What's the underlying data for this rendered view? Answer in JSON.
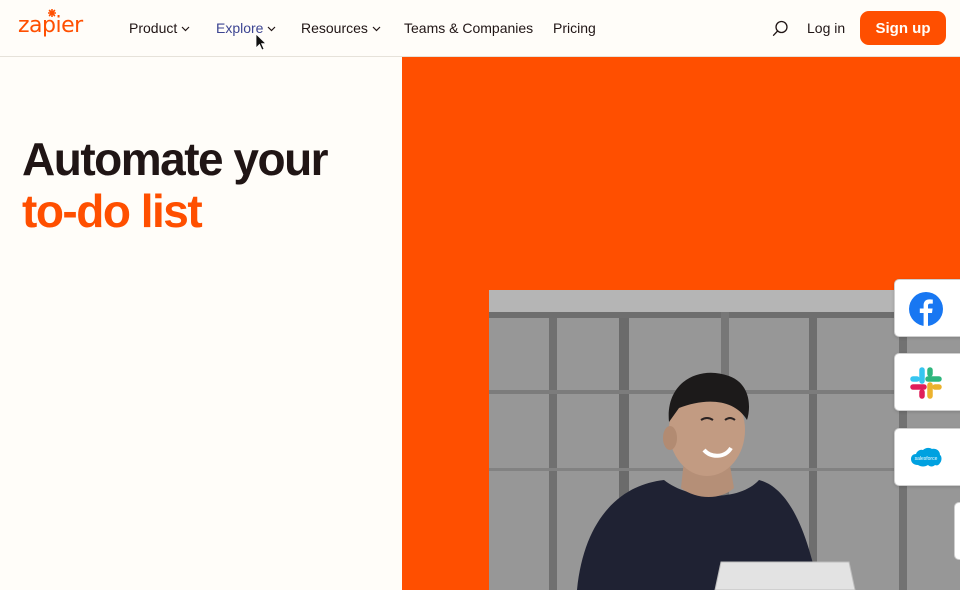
{
  "header": {
    "logo_text": "zapier",
    "nav": [
      {
        "label": "Product",
        "has_dropdown": true
      },
      {
        "label": "Explore",
        "has_dropdown": true,
        "active": true
      },
      {
        "label": "Resources",
        "has_dropdown": true
      },
      {
        "label": "Teams & Companies",
        "has_dropdown": false
      },
      {
        "label": "Pricing",
        "has_dropdown": false
      }
    ],
    "search_icon": "search-icon",
    "login_label": "Log in",
    "signup_label": "Sign up"
  },
  "hero": {
    "line1": "Automate your",
    "line2": "to-do list"
  },
  "visual": {
    "app_icons": [
      "facebook-icon",
      "slack-icon",
      "salesforce-icon"
    ],
    "salesforce_wordmark": "salesforce"
  },
  "colors": {
    "brand_orange": "#ff4f00",
    "nav_active": "#3d4592",
    "text_dark": "#201515",
    "background": "#fffdf9"
  }
}
